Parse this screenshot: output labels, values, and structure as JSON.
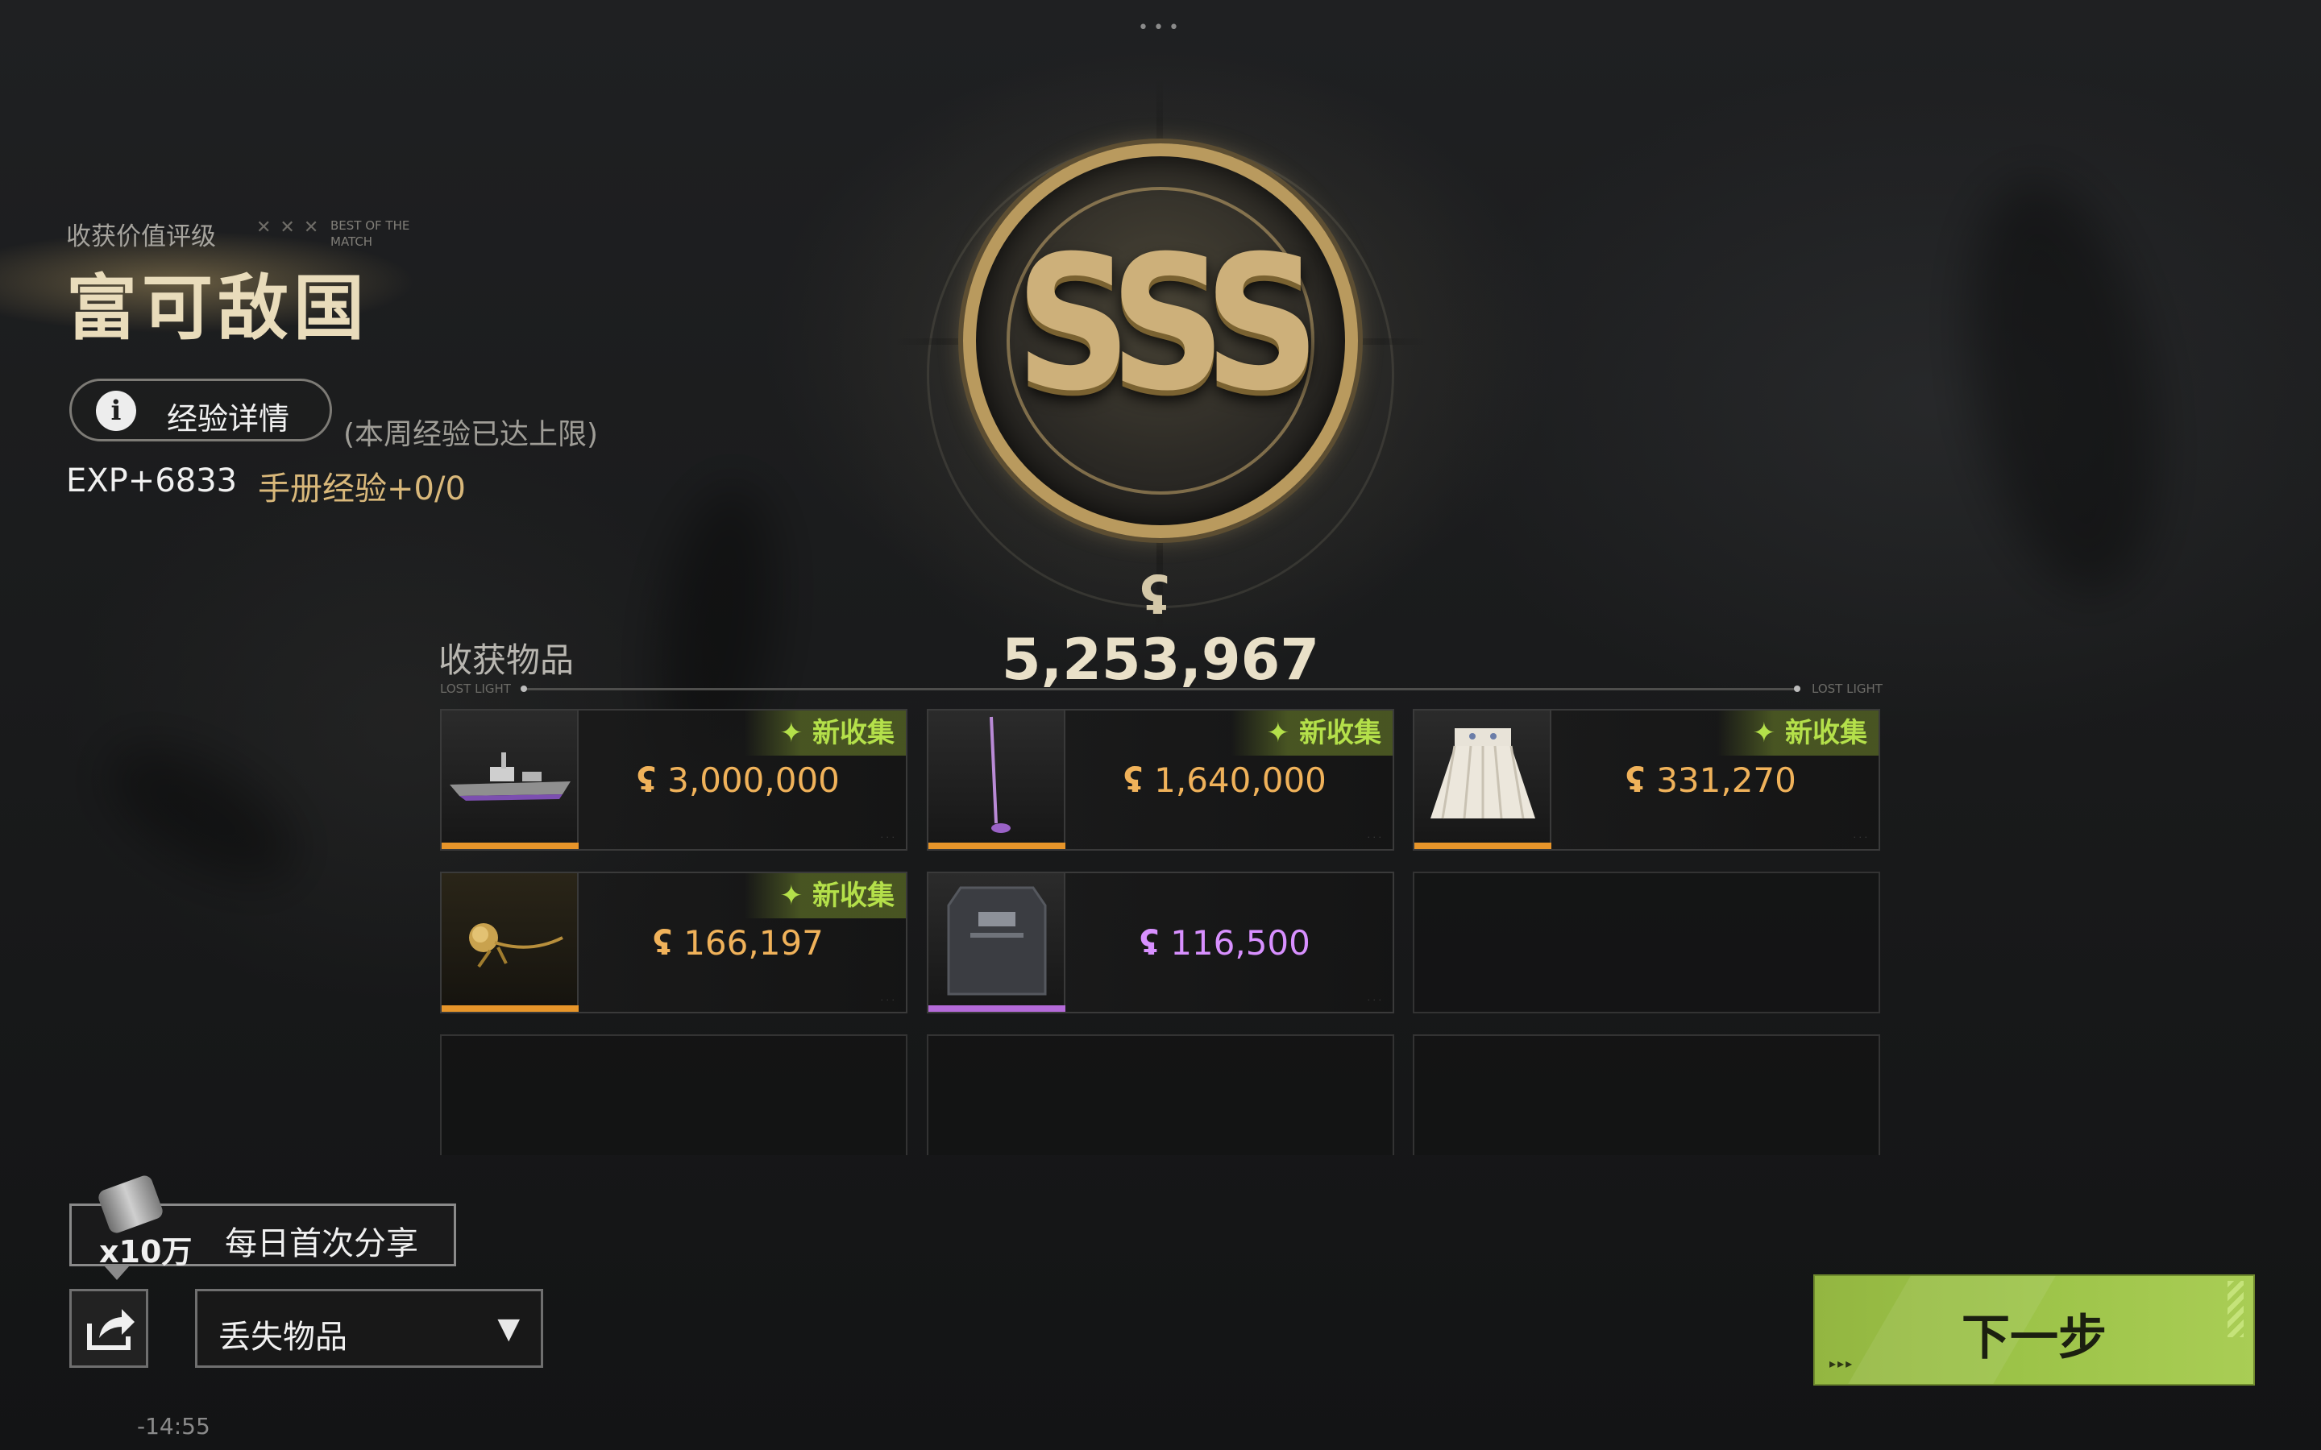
{
  "header": {
    "rating_label": "收获价值评级",
    "best_of": "BEST OF THE MATCH",
    "rating_title": "富可敌国",
    "exp_button_label": "经验详情",
    "weekly_cap_note": "(本周经验已达上限)",
    "exp_value": "EXP+6833",
    "handbook_exp": "手册经验+0/0"
  },
  "medal": {
    "grade": "SSS",
    "total_value": "5,253,967"
  },
  "items_section": {
    "title": "收获物品",
    "tag_left": "LOST LIGHT",
    "tag_right": "LOST LIGHT",
    "items": [
      {
        "price": "3,000,000",
        "new_label": "✦ 新收集",
        "is_new": true,
        "rarity": "gold",
        "icon": "warship-model-icon"
      },
      {
        "price": "1,640,000",
        "new_label": "✦ 新收集",
        "is_new": true,
        "rarity": "gold",
        "icon": "golf-club-icon"
      },
      {
        "price": "331,270",
        "new_label": "✦ 新收集",
        "is_new": true,
        "rarity": "gold",
        "icon": "pleated-skirt-icon"
      },
      {
        "price": "166,197",
        "new_label": "✦ 新收集",
        "is_new": true,
        "rarity": "gold",
        "icon": "golden-rose-icon"
      },
      {
        "price": "116,500",
        "new_label": "",
        "is_new": false,
        "rarity": "purple",
        "icon": "armor-plate-icon"
      }
    ]
  },
  "share": {
    "multiplier": "x10万",
    "label": "每日首次分享"
  },
  "dropdown": {
    "selected": "丢失物品"
  },
  "timer": "-14:55",
  "next_button": {
    "label": "下一步"
  },
  "colors": {
    "gold_rarity": "#e7952a",
    "purple_rarity": "#b46ad8",
    "new_badge": "#b4e04a",
    "accent_green": "#9cc348"
  }
}
